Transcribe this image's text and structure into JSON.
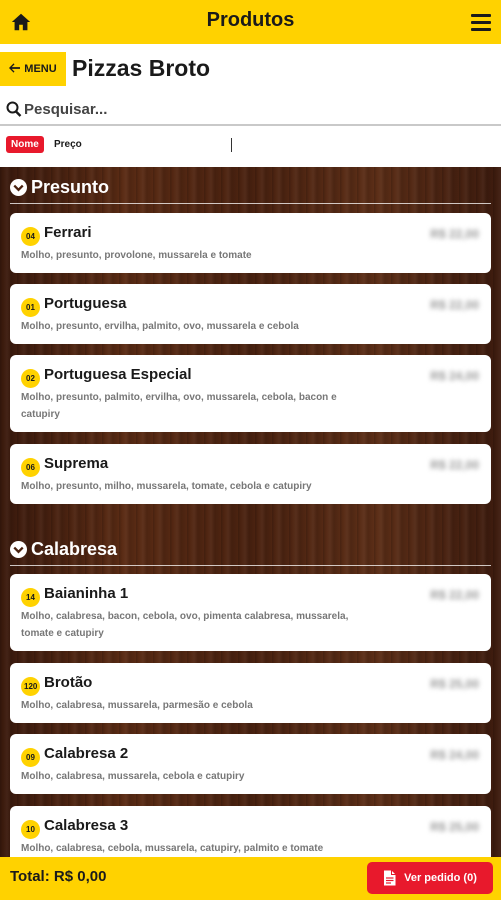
{
  "header": {
    "title": "Produtos"
  },
  "subheader": {
    "menu_label": "MENU",
    "page_title": "Pizzas Broto"
  },
  "search": {
    "placeholder": "Pesquisar..."
  },
  "sort": {
    "name_label": "Nome",
    "price_label": "Preço"
  },
  "sections": [
    {
      "title": "Presunto",
      "items": [
        {
          "code": "04",
          "name": "Ferrari",
          "desc": "Molho, presunto, provolone, mussarela e tomate",
          "price": "R$ 22,00"
        },
        {
          "code": "01",
          "name": "Portuguesa",
          "desc": "Molho, presunto, ervilha, palmito, ovo, mussarela e cebola",
          "price": "R$ 22,00"
        },
        {
          "code": "02",
          "name": "Portuguesa Especial",
          "desc": "Molho, presunto, palmito, ervilha, ovo, mussarela, cebola, bacon e catupiry",
          "price": "R$ 24,00"
        },
        {
          "code": "06",
          "name": "Suprema",
          "desc": "Molho, presunto, milho, mussarela, tomate, cebola e catupiry",
          "price": "R$ 22,00"
        }
      ]
    },
    {
      "title": "Calabresa",
      "items": [
        {
          "code": "14",
          "name": "Baianinha 1",
          "desc": "Molho, calabresa, bacon, cebola, ovo, pimenta calabresa, mussarela, tomate e catupiry",
          "price": "R$ 22,00"
        },
        {
          "code": "120",
          "name": "Brotão",
          "desc": "Molho, calabresa, mussarela, parmesão e cebola",
          "price": "R$ 25,00"
        },
        {
          "code": "09",
          "name": "Calabresa 2",
          "desc": "Molho, calabresa, mussarela, cebola e catupiry",
          "price": "R$ 24,00"
        },
        {
          "code": "10",
          "name": "Calabresa 3",
          "desc": "Molho, calabresa, cebola, mussarela, catupiry, palmito e tomate",
          "price": "R$ 25,00"
        }
      ]
    }
  ],
  "footer": {
    "total": "Total: R$ 0,00",
    "order_button": "Ver pedido (0)"
  },
  "colors": {
    "accent": "#ffd200",
    "danger": "#e8192c",
    "wood": "#4a2210"
  }
}
